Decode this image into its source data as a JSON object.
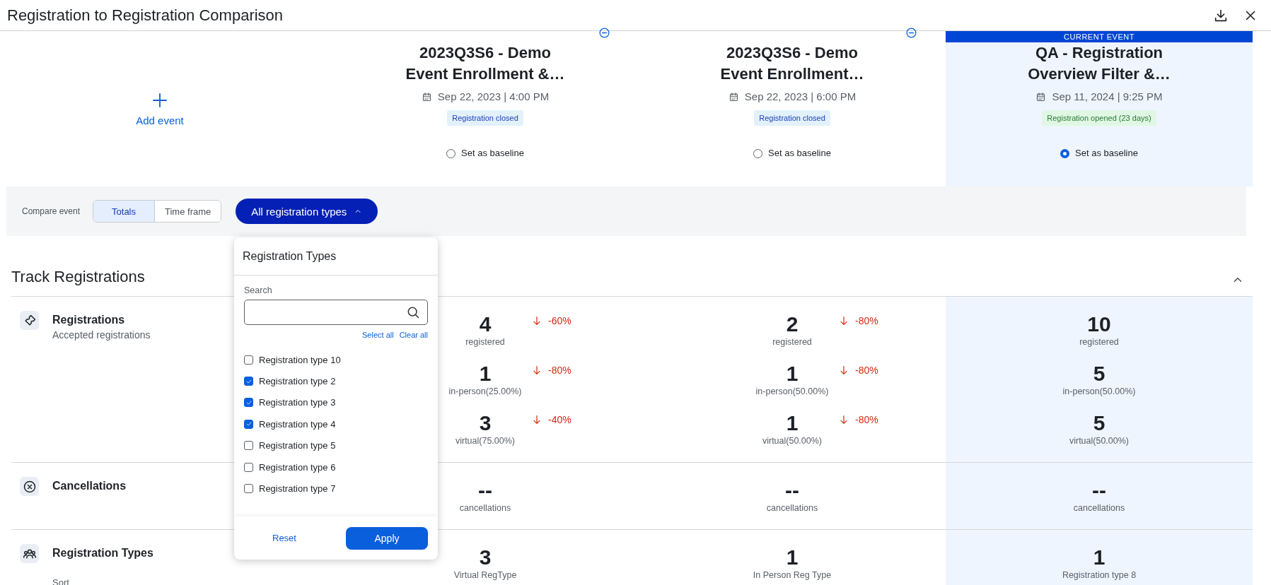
{
  "window": {
    "title": "Registration to Registration Comparison"
  },
  "events": [
    {
      "kind": "add",
      "label": "Add event"
    },
    {
      "kind": "event",
      "name": "2023Q3S6 - Demo Event Enrollment &…",
      "date": "Sep 22, 2023 | 4:00 PM",
      "status": {
        "label": "Registration closed",
        "kind": "closed"
      },
      "baseline_label": "Set as baseline",
      "baseline_selected": false,
      "removable": true
    },
    {
      "kind": "event",
      "name": "2023Q3S6 - Demo Event Enrollment…",
      "date": "Sep 22, 2023 | 6:00 PM",
      "status": {
        "label": "Registration closed",
        "kind": "closed"
      },
      "baseline_label": "Set as baseline",
      "baseline_selected": false,
      "removable": true
    },
    {
      "kind": "event",
      "name": "QA - Registration Overview Filter &…",
      "date": "Sep 11, 2024 | 9:25 PM",
      "status": {
        "label": "Registration opened (23 days)",
        "kind": "open"
      },
      "baseline_label": "Set as baseline",
      "baseline_selected": true,
      "current_label": "CURRENT EVENT"
    }
  ],
  "toolbar": {
    "compare_label": "Compare event",
    "segments": [
      {
        "label": "Totals",
        "selected": true
      },
      {
        "label": "Time frame",
        "selected": false
      }
    ],
    "filter": {
      "label": "All registration types",
      "expanded": true
    }
  },
  "dropdown": {
    "title": "Registration Types",
    "search_label": "Search",
    "select_all": "Select all",
    "clear_all": "Clear all",
    "options": [
      {
        "label": "Registration type 10",
        "checked": false
      },
      {
        "label": "Registration type 2",
        "checked": true
      },
      {
        "label": "Registration type 3",
        "checked": true
      },
      {
        "label": "Registration type 4",
        "checked": true
      },
      {
        "label": "Registration type 5",
        "checked": false
      },
      {
        "label": "Registration type 6",
        "checked": false
      },
      {
        "label": "Registration type 7",
        "checked": false
      }
    ],
    "reset": "Reset",
    "apply": "Apply"
  },
  "section": {
    "title": "Track Registrations",
    "expanded": true
  },
  "metrics": [
    {
      "kind": "ticket",
      "title": "Registrations",
      "subtitle": "Accepted registrations",
      "cells": [
        [
          {
            "value": "4",
            "label": "registered",
            "change": {
              "text": "-60%",
              "kind": "down"
            }
          },
          {
            "value": "1",
            "label": "in-person(25.00%)",
            "change": {
              "text": "-80%",
              "kind": "down"
            }
          },
          {
            "value": "3",
            "label": "virtual(75.00%)",
            "change": {
              "text": "-40%",
              "kind": "down"
            }
          }
        ],
        [
          {
            "value": "2",
            "label": "registered",
            "change": {
              "text": "-80%",
              "kind": "down"
            }
          },
          {
            "value": "1",
            "label": "in-person(50.00%)",
            "change": {
              "text": "-80%",
              "kind": "down"
            }
          },
          {
            "value": "1",
            "label": "virtual(50.00%)",
            "change": {
              "text": "-80%",
              "kind": "down"
            }
          }
        ],
        [
          {
            "value": "10",
            "label": "registered"
          },
          {
            "value": "5",
            "label": "in-person(50.00%)"
          },
          {
            "value": "5",
            "label": "virtual(50.00%)"
          }
        ]
      ]
    },
    {
      "kind": "cancel",
      "title": "Cancellations",
      "cells": [
        [
          {
            "value": "--",
            "label": "cancellations"
          }
        ],
        [
          {
            "value": "--",
            "label": "cancellations"
          }
        ],
        [
          {
            "value": "--",
            "label": "cancellations"
          }
        ]
      ]
    },
    {
      "kind": "people",
      "title": "Registration Types",
      "sort_label": "Sort",
      "cells": [
        [
          {
            "value": "3",
            "label": "Virtual RegType"
          }
        ],
        [
          {
            "value": "1",
            "label": "In Person Reg Type"
          }
        ],
        [
          {
            "value": "1",
            "label": "Registration type 8"
          }
        ]
      ]
    }
  ]
}
